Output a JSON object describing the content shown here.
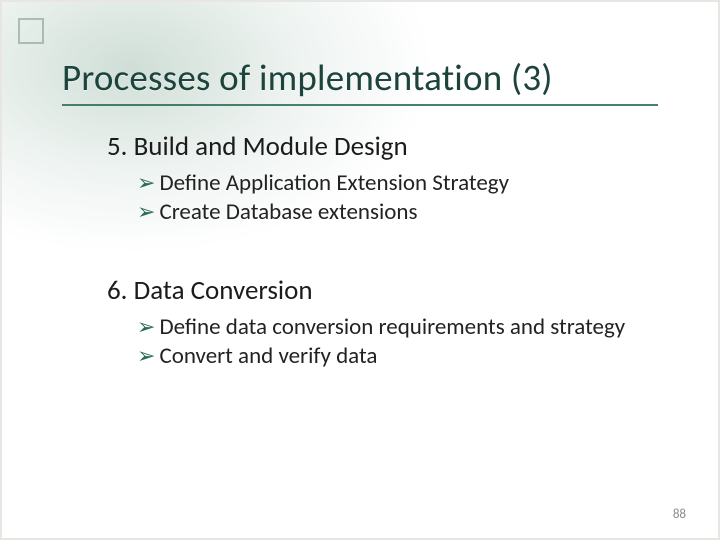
{
  "title": "Processes of implementation (3)",
  "sections": [
    {
      "heading": "5. Build and Module Design",
      "bullets": [
        "Define Application Extension Strategy",
        "Create Database extensions"
      ]
    },
    {
      "heading": "6. Data Conversion",
      "bullets": [
        "Define data conversion requirements and strategy",
        "Convert and verify data"
      ]
    }
  ],
  "page_number": "88",
  "bullet_glyph": "➢"
}
